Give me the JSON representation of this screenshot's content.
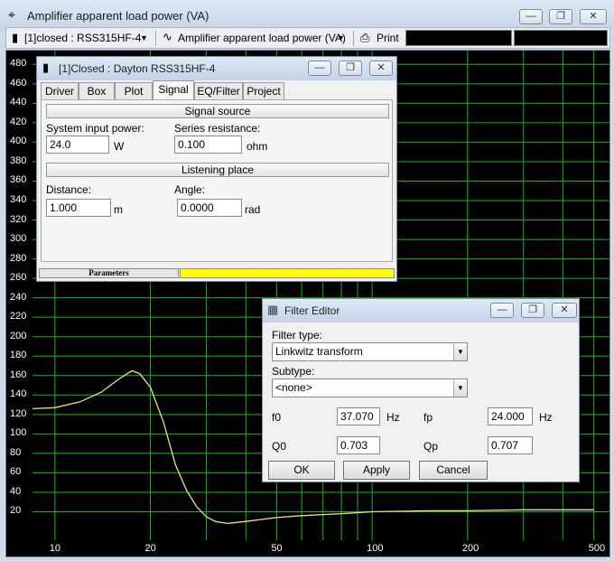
{
  "main": {
    "title": "Amplifier apparent load power (VA)",
    "app_icon": "pin-icon",
    "toolbar": {
      "project_combo": "[1]closed : RSS315HF-4",
      "chart_combo": "Amplifier apparent load power (VA)",
      "print_label": "Print"
    }
  },
  "plot": {
    "yticks": [
      "480",
      "460",
      "440",
      "420",
      "400",
      "380",
      "360",
      "340",
      "320",
      "300",
      "280",
      "260",
      "240",
      "220",
      "200",
      "180",
      "160",
      "140",
      "120",
      "100",
      "80",
      "60",
      "40",
      "20"
    ],
    "xticks": [
      "10",
      "20",
      "50",
      "100",
      "200",
      "500"
    ],
    "grid_color": "#1fb31f",
    "curve_color": "#e6e67a",
    "curve": [
      [
        8.5,
        126
      ],
      [
        10,
        127
      ],
      [
        12,
        133
      ],
      [
        14,
        143
      ],
      [
        16,
        157
      ],
      [
        17.5,
        165
      ],
      [
        18.5,
        162
      ],
      [
        20,
        148
      ],
      [
        22,
        112
      ],
      [
        24,
        68
      ],
      [
        26,
        42
      ],
      [
        28,
        25
      ],
      [
        30,
        15
      ],
      [
        32,
        10
      ],
      [
        35,
        8
      ],
      [
        40,
        10
      ],
      [
        50,
        14
      ],
      [
        60,
        16
      ],
      [
        80,
        18
      ],
      [
        100,
        20
      ],
      [
        150,
        21
      ],
      [
        200,
        21
      ],
      [
        300,
        22
      ],
      [
        500,
        22
      ]
    ]
  },
  "props_window": {
    "title": "[1]Closed : Dayton RSS315HF-4",
    "tabs": [
      "Driver",
      "Box",
      "Plot",
      "Signal",
      "EQ/Filter",
      "Project"
    ],
    "active_tab": "Signal",
    "signal_source_header": "Signal source",
    "system_input_power_label": "System input power:",
    "system_input_power_value": "24.0",
    "system_input_power_unit": "W",
    "series_resistance_label": "Series resistance:",
    "series_resistance_value": "0.100",
    "series_resistance_unit": "ohm",
    "listening_place_header": "Listening place",
    "distance_label": "Distance:",
    "distance_value": "1.000",
    "distance_unit": "m",
    "angle_label": "Angle:",
    "angle_value": "0.0000",
    "angle_unit": "rad",
    "status_parameters": "Parameters",
    "status_color": "#ffff00"
  },
  "filter_editor": {
    "title": "Filter Editor",
    "filter_type_label": "Filter type:",
    "filter_type_value": "Linkwitz transform",
    "subtype_label": "Subtype:",
    "subtype_value": "<none>",
    "f0_label": "f0",
    "f0_value": "37.070",
    "f0_unit": "Hz",
    "fp_label": "fp",
    "fp_value": "24.000",
    "fp_unit": "Hz",
    "q0_label": "Q0",
    "q0_value": "0.703",
    "qp_label": "Qp",
    "qp_value": "0.707",
    "ok_label": "OK",
    "apply_label": "Apply",
    "cancel_label": "Cancel"
  }
}
